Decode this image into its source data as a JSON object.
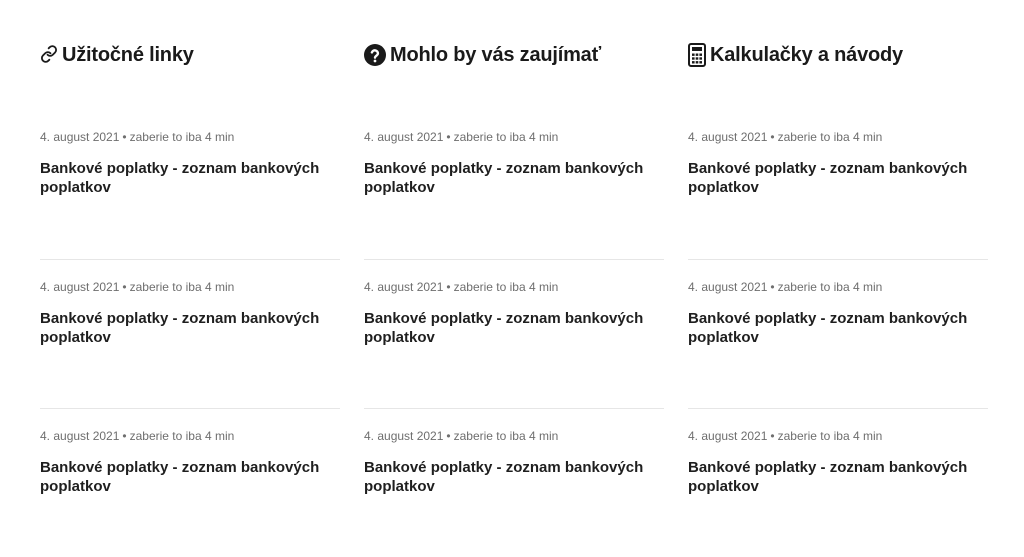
{
  "columns": [
    {
      "title": "Užitočné linky",
      "icon": "link-icon",
      "articles": [
        {
          "date": "4. august 2021",
          "separator": "•",
          "read_time": "zaberie to iba 4 min",
          "title": "Bankové poplatky - zoznam bankových poplatkov"
        },
        {
          "date": "4. august 2021",
          "separator": "•",
          "read_time": "zaberie to iba 4 min",
          "title": "Bankové poplatky - zoznam bankových poplatkov"
        },
        {
          "date": "4. august 2021",
          "separator": "•",
          "read_time": "zaberie to iba 4 min",
          "title": "Bankové poplatky - zoznam bankových poplatkov"
        }
      ]
    },
    {
      "title": "Mohlo by vás zaujímať",
      "icon": "question-circle-icon",
      "articles": [
        {
          "date": "4. august 2021",
          "separator": "•",
          "read_time": "zaberie to iba 4 min",
          "title": "Bankové poplatky - zoznam bankových poplatkov"
        },
        {
          "date": "4. august 2021",
          "separator": "•",
          "read_time": "zaberie to iba 4 min",
          "title": "Bankové poplatky - zoznam bankových poplatkov"
        },
        {
          "date": "4. august 2021",
          "separator": "•",
          "read_time": "zaberie to iba 4 min",
          "title": "Bankové poplatky - zoznam bankových poplatkov"
        }
      ]
    },
    {
      "title": "Kalkulačky a návody",
      "icon": "calculator-icon",
      "articles": [
        {
          "date": "4. august 2021",
          "separator": "•",
          "read_time": "zaberie to iba 4 min",
          "title": "Bankové poplatky - zoznam bankových poplatkov"
        },
        {
          "date": "4. august 2021",
          "separator": "•",
          "read_time": "zaberie to iba 4 min",
          "title": "Bankové poplatky - zoznam bankových poplatkov"
        },
        {
          "date": "4. august 2021",
          "separator": "•",
          "read_time": "zaberie to iba 4 min",
          "title": "Bankové poplatky - zoznam bankových poplatkov"
        }
      ]
    }
  ]
}
